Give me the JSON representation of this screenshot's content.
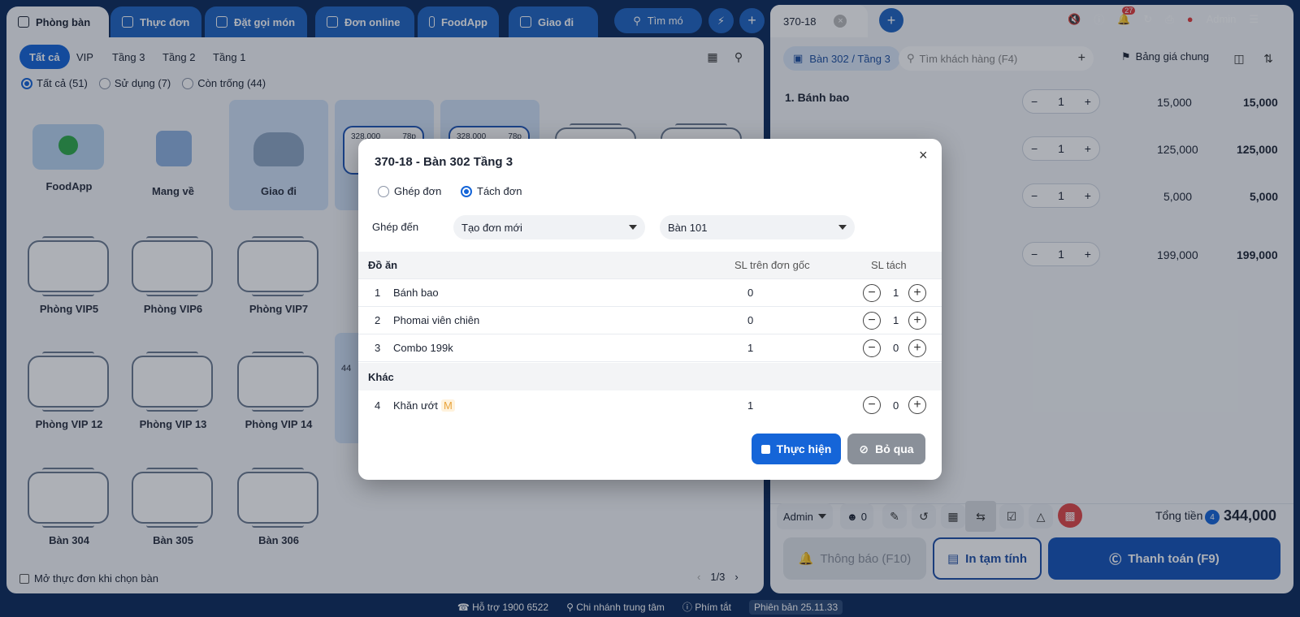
{
  "top_tabs": [
    {
      "label": "Phòng bàn",
      "icon": "table-icon"
    },
    {
      "label": "Thực đơn",
      "icon": "menu-icon"
    },
    {
      "label": "Đặt gọi món",
      "icon": "order-icon"
    },
    {
      "label": "Đơn online",
      "icon": "bag-icon"
    },
    {
      "label": "FoodApp",
      "icon": "login-icon"
    },
    {
      "label": "Giao đi",
      "icon": "bag-icon"
    }
  ],
  "top_search": {
    "label": "Tìm mó"
  },
  "filters": {
    "chips": [
      "Tất cả",
      "VIP",
      "Tầng 3",
      "Tầng 2",
      "Tầng 1"
    ],
    "status": [
      "Tất cả (51)",
      "Sử dụng (7)",
      "Còn trống (44)"
    ]
  },
  "cards": {
    "foodapp": "FoodApp",
    "mangve": "Mang về",
    "giaodi": "Giao đi",
    "busy1_price": "328,000",
    "busy1_time": "78p",
    "busy2_price": "328,000",
    "busy2_time": "78p",
    "busy3_price": "44"
  },
  "tables": [
    "Phòng VIP5",
    "Phòng VIP6",
    "Phòng VIP7",
    "Phòng VIP 12",
    "Phòng VIP 13",
    "Phòng VIP 14",
    "Bàn 304",
    "Bàn 305",
    "Bàn 306"
  ],
  "left_footer": {
    "checkbox_label": "Mở thực đơn khi chọn bàn",
    "page": "1/3"
  },
  "right": {
    "order_tab": "370-18",
    "table_chip": "Bàn 302 / Tầng 3",
    "customer_placeholder": "Tìm khách hàng (F4)",
    "price_list": "Bảng giá chung",
    "user": "Admin",
    "notif_count": "27",
    "items": [
      {
        "name": "1. Bánh bao",
        "qty": "1",
        "price": "15,000",
        "total": "15,000"
      },
      {
        "name": "",
        "qty": "1",
        "price": "125,000",
        "total": "125,000"
      },
      {
        "name": "",
        "qty": "1",
        "price": "5,000",
        "total": "5,000"
      },
      {
        "name": "",
        "qty": "1",
        "price": "199,000",
        "total": "199,000"
      }
    ],
    "staff": "Admin",
    "guest_count": "0",
    "total_label": "Tổng tiền",
    "total_count": "4",
    "total_value": "344,000",
    "btn_notify": "Thông báo (F10)",
    "btn_print": "In tạm tính",
    "btn_pay": "Thanh toán (F9)"
  },
  "footer": {
    "support": "Hỗ trợ 1900 6522",
    "branch": "Chi nhánh trung tâm",
    "shortcut": "Phím tắt",
    "version": "Phiên bản 25.11.33"
  },
  "modal": {
    "title": "370-18 - Bàn 302 Tầng 3",
    "opt_merge": "Ghép đơn",
    "opt_split": "Tách đơn",
    "target_label": "Ghép đến",
    "target_order": "Tạo đơn mới",
    "target_table": "Bàn 101",
    "col_name": "Đồ ăn",
    "col_orig": "SL trên đơn gốc",
    "col_split": "SL tách",
    "group2": "Khác",
    "rows": [
      {
        "no": "1",
        "name": "Bánh bao",
        "orig": "0",
        "split": "1"
      },
      {
        "no": "2",
        "name": "Phomai viên chiên",
        "orig": "0",
        "split": "1"
      },
      {
        "no": "3",
        "name": "Combo 199k",
        "orig": "1",
        "split": "0"
      },
      {
        "no": "4",
        "name": "Khăn ướt",
        "orig": "1",
        "split": "0",
        "tag": "M"
      }
    ],
    "btn_ok": "Thực hiện",
    "btn_cancel": "Bỏ qua"
  }
}
